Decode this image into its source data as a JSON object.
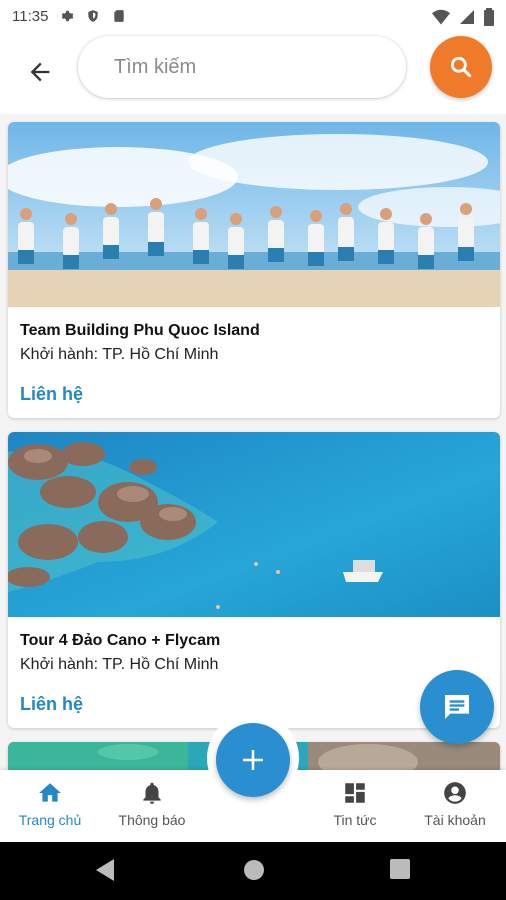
{
  "status_bar": {
    "time": "11:35"
  },
  "search": {
    "placeholder": "Tìm kiếm"
  },
  "colors": {
    "accent_orange": "#ef7a2a",
    "accent_blue": "#2a8fd0",
    "link_blue": "#2389c6"
  },
  "tours": [
    {
      "title": "Team Building Phu Quoc Island",
      "departure": "Khởi hành: TP. Hồ Chí Minh",
      "contact_label": "Liên hệ",
      "image_icon": "beach-group-photo"
    },
    {
      "title": "Tour 4 Đảo Cano + Flycam",
      "departure": "Khởi hành: TP. Hồ Chí Minh",
      "contact_label": "Liên hệ",
      "image_icon": "sea-rocks-photo"
    }
  ],
  "bottom_nav": {
    "items": [
      {
        "label": "Trang chủ",
        "icon": "home-icon",
        "active": true
      },
      {
        "label": "Thông báo",
        "icon": "bell-icon",
        "active": false
      },
      {
        "label": "Tin tức",
        "icon": "dashboard-icon",
        "active": false
      },
      {
        "label": "Tài khoản",
        "icon": "account-icon",
        "active": false
      }
    ]
  }
}
